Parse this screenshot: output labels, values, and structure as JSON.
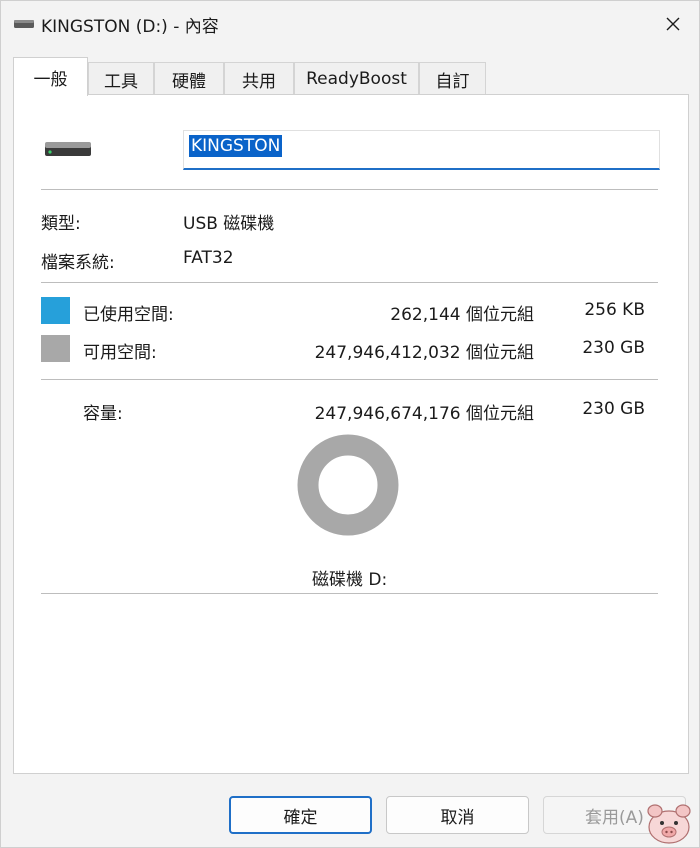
{
  "window": {
    "title": "KINGSTON (D:) - 內容",
    "close_glyph": "✕"
  },
  "tabs": [
    {
      "label": "一般",
      "active": true
    },
    {
      "label": "工具"
    },
    {
      "label": "硬體"
    },
    {
      "label": "共用"
    },
    {
      "label": "ReadyBoost"
    },
    {
      "label": "自訂"
    }
  ],
  "general": {
    "volume_name": "KINGSTON",
    "type_label": "類型:",
    "type_value": "USB 磁碟機",
    "fs_label": "檔案系統:",
    "fs_value": "FAT32",
    "used_label": "已使用空間:",
    "used_bytes": "262,144 個位元組",
    "used_size": "256 KB",
    "free_label": "可用空間:",
    "free_bytes": "247,946,412,032 個位元組",
    "free_size": "230 GB",
    "capacity_label": "容量:",
    "capacity_bytes": "247,946,674,176 個位元組",
    "capacity_size": "230 GB",
    "drive_label": "磁碟機 D:",
    "used_fraction": 1e-06,
    "colors": {
      "used": "#26a0da",
      "free": "#a8a8a8"
    }
  },
  "buttons": {
    "ok": "確定",
    "cancel": "取消",
    "apply": "套用(A)"
  }
}
